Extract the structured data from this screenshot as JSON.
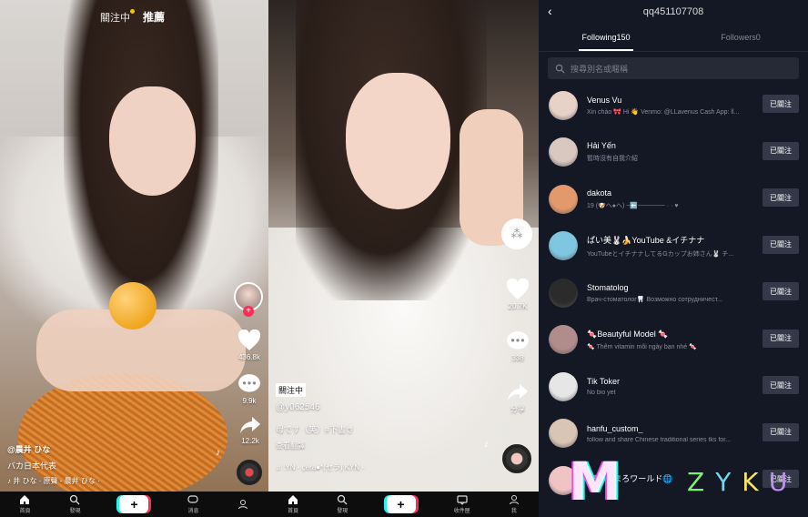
{
  "panel1": {
    "top_tabs": {
      "following": "關注中",
      "for_you": "推薦"
    },
    "counts": {
      "likes": "436.8k",
      "comments": "9.9k",
      "shares": "12.2k"
    },
    "username": "@晨井 ひな",
    "description": "バカ日本代表",
    "music": "♪ 井 ひな · 原聲 - 晨井 ひな ·",
    "bottom_tabs": [
      "首頁",
      "發現",
      "",
      "消息",
      ""
    ]
  },
  "panel2": {
    "follow_badge": "關注中",
    "counts": {
      "likes": "20.7K",
      "comments": "338",
      "share_label": "分享"
    },
    "username": "@y062546",
    "description": "母です（笑）#下書き",
    "translate": "查看翻譯",
    "music": "♫  :YN - çera●*(セラ)   KYN -",
    "bottom_tabs": [
      "首頁",
      "發現",
      "",
      "收件匣",
      "我"
    ]
  },
  "panel3": {
    "title": "qq451107708",
    "tabs": {
      "following": "Following150",
      "followers": "Followers0"
    },
    "search_placeholder": "搜尋別名或暱稱",
    "follow_label": "已關注",
    "users": [
      {
        "name": "Venus Vu",
        "desc": "Xin chào 🎀 Hi 👋 Venmo: @LLavenus Cash App: ll...",
        "color": "#e8d2c8"
      },
      {
        "name": "Hải Yến",
        "desc": "暫時沒有自我介紹",
        "color": "#d9c8c0"
      },
      {
        "name": "dakota",
        "desc": "19 (🐶ヘ●ヘ) ~⬅️────── · · ♥",
        "color": "#e29a6c"
      },
      {
        "name": "ぱい美🐰🍌YouTube &イチナナ",
        "desc": "YouTubeとイチナナしてるGカップお姉さん🐰 チ...",
        "color": "#7fc7e0"
      },
      {
        "name": "Stomatolog",
        "desc": "Врач-стоматолог🦷 Возможно сотрудничест...",
        "color": "#2b2b2b"
      },
      {
        "name": "🍬Beautyful Model 🍬",
        "desc": "🍬 Thêm vitamin mỗi ngày bạn nhé 🍬",
        "color": "#b08c8a"
      },
      {
        "name": "Tik Toker",
        "desc": "No bio yet",
        "color": "#e6e6e6"
      },
      {
        "name": "hanfu_custom_",
        "desc": "follow and share Chinese traditional series  tks for...",
        "color": "#d8c5b5"
      },
      {
        "name": "🎀まいまろワールド🌐",
        "desc": "",
        "color": "#f0c4c4"
      }
    ]
  },
  "watermark": {
    "letters": [
      "Z",
      "Y",
      "K",
      "U"
    ]
  }
}
